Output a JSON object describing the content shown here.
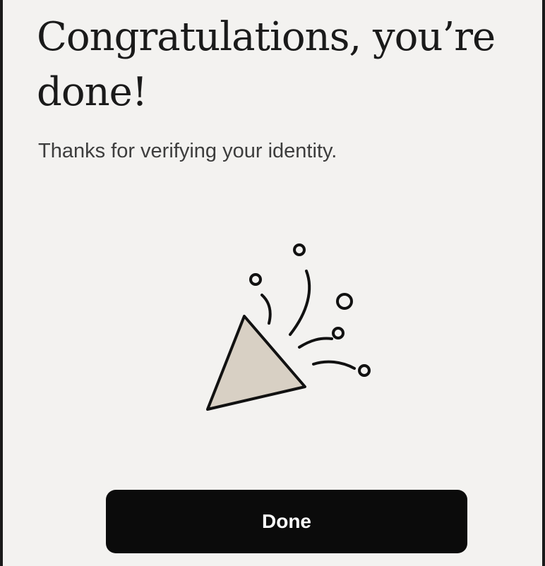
{
  "screen": {
    "heading": "Congratulations, you’re done!",
    "subtitle": "Thanks for verifying your identity.",
    "illustration_icon": "party-popper-icon",
    "done_button_label": "Done"
  },
  "colors": {
    "background": "#f3f2f0",
    "button": "#0b0b0b",
    "button_text": "#ffffff",
    "popper_fill": "#d8d0c4"
  }
}
